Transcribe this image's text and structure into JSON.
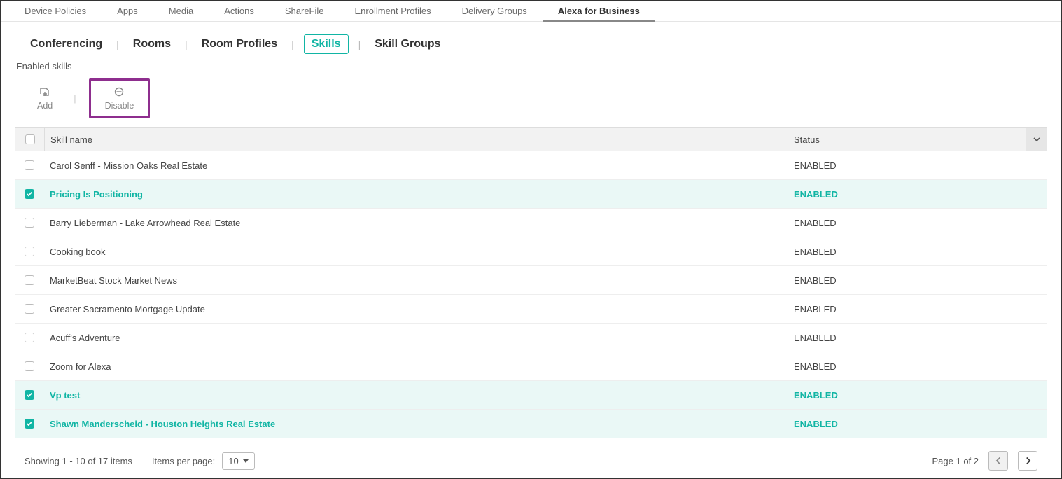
{
  "topNav": {
    "items": [
      {
        "label": "Device Policies"
      },
      {
        "label": "Apps"
      },
      {
        "label": "Media"
      },
      {
        "label": "Actions"
      },
      {
        "label": "ShareFile"
      },
      {
        "label": "Enrollment Profiles"
      },
      {
        "label": "Delivery Groups"
      },
      {
        "label": "Alexa for Business",
        "active": true
      }
    ]
  },
  "subNav": {
    "items": [
      {
        "label": "Conferencing"
      },
      {
        "label": "Rooms"
      },
      {
        "label": "Room Profiles"
      },
      {
        "label": "Skills",
        "active": true
      },
      {
        "label": "Skill Groups"
      }
    ]
  },
  "section": {
    "title": "Enabled skills"
  },
  "toolbar": {
    "add_label": "Add",
    "disable_label": "Disable"
  },
  "table": {
    "headers": {
      "name": "Skill name",
      "status": "Status"
    },
    "rows": [
      {
        "name": "Carol Senff - Mission Oaks Real Estate",
        "status": "ENABLED",
        "selected": false
      },
      {
        "name": "Pricing Is Positioning",
        "status": "ENABLED",
        "selected": true
      },
      {
        "name": "Barry Lieberman - Lake Arrowhead Real Estate",
        "status": "ENABLED",
        "selected": false
      },
      {
        "name": "Cooking book",
        "status": "ENABLED",
        "selected": false
      },
      {
        "name": "MarketBeat Stock Market News",
        "status": "ENABLED",
        "selected": false
      },
      {
        "name": "Greater Sacramento Mortgage Update",
        "status": "ENABLED",
        "selected": false
      },
      {
        "name": "Acuff's Adventure",
        "status": "ENABLED",
        "selected": false
      },
      {
        "name": "Zoom for Alexa",
        "status": "ENABLED",
        "selected": false
      },
      {
        "name": "Vp test",
        "status": "ENABLED",
        "selected": true
      },
      {
        "name": "Shawn Manderscheid - Houston Heights Real Estate",
        "status": "ENABLED",
        "selected": true
      }
    ]
  },
  "footer": {
    "showing": "Showing 1 - 10 of 17 items",
    "items_per_page_label": "Items per page:",
    "items_per_page_value": "10",
    "page_label": "Page 1 of 2"
  }
}
